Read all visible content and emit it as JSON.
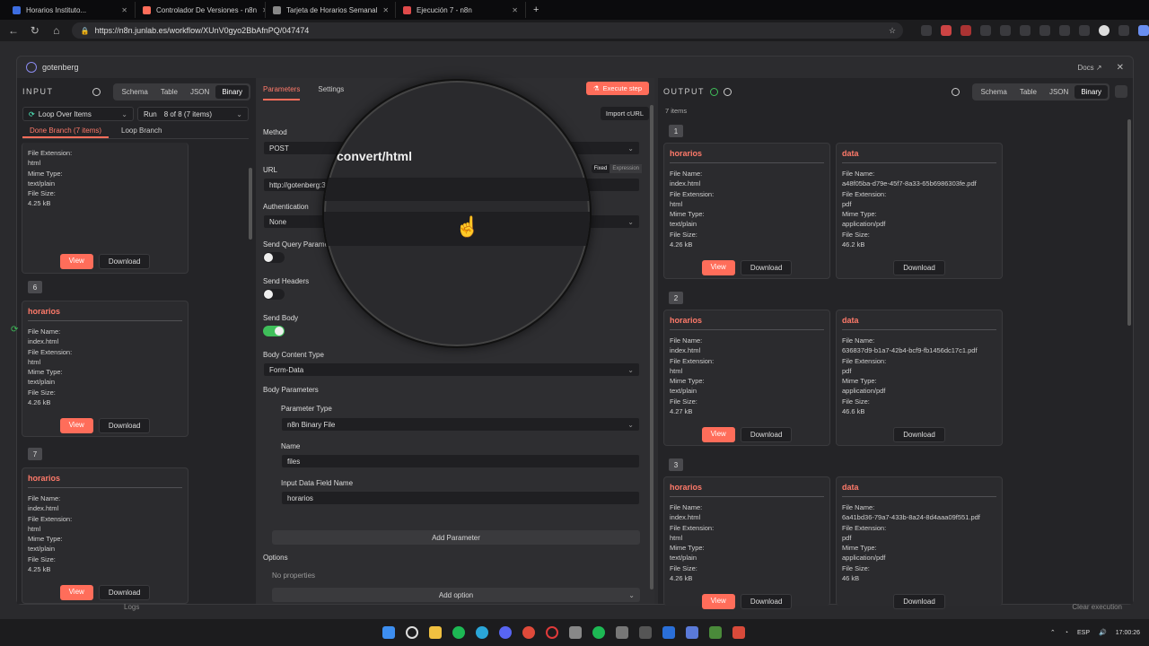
{
  "browser": {
    "tabs": [
      {
        "label": "Horarios Instituto..."
      },
      {
        "label": "Controlador De Versiones - n8n"
      },
      {
        "label": "Tarjeta de Horarios Semanal"
      },
      {
        "label": "Ejecución 7 - n8n"
      }
    ],
    "url": "https://n8n.junlab.es/workflow/XUnV0gyo2BbAfnPQ/047474"
  },
  "modal": {
    "node_name": "gotenberg",
    "docs_label": "Docs"
  },
  "input_pane": {
    "title": "INPUT",
    "view_tabs": [
      "Schema",
      "Table",
      "JSON",
      "Binary"
    ],
    "active_view": "Binary",
    "source_select": "Loop Over Items",
    "run_label": "Run",
    "run_select": "8 of 8 (7 items)",
    "branch_tabs": [
      "Done Branch (7 items)",
      "Loop Branch"
    ],
    "partial_card": {
      "rows": [
        "File Extension:",
        "html",
        "Mime Type:",
        "text/plain",
        "File Size:",
        "4.25 kB"
      ]
    },
    "items": [
      {
        "index": "6",
        "title": "horarios",
        "rows": [
          "File Name:",
          "index.html",
          "File Extension:",
          "html",
          "Mime Type:",
          "text/plain",
          "File Size:",
          "4.26 kB"
        ]
      },
      {
        "index": "7",
        "title": "horarios",
        "rows": [
          "File Name:",
          "index.html",
          "File Extension:",
          "html",
          "Mime Type:",
          "text/plain",
          "File Size:",
          "4.25 kB"
        ]
      }
    ],
    "view_label": "View",
    "download_label": "Download"
  },
  "params_pane": {
    "tabs": [
      "Parameters",
      "Settings"
    ],
    "execute_label": "Execute step",
    "import_curl": "Import cURL",
    "method_label": "Method",
    "method_value": "POST",
    "url_label": "URL",
    "url_value": "http://gotenberg:3",
    "url_mode": [
      "Fixed",
      "Expression"
    ],
    "auth_label": "Authentication",
    "auth_value": "None",
    "send_query_label": "Send Query Parame",
    "send_headers_label": "Send Headers",
    "send_body_label": "Send Body",
    "body_content_type_label": "Body Content Type",
    "body_content_type_value": "Form-Data",
    "body_params_label": "Body Parameters",
    "param_type_label": "Parameter Type",
    "param_type_value": "n8n Binary File",
    "name_label": "Name",
    "name_value": "files",
    "input_field_label": "Input Data Field Name",
    "input_field_value": "horarios",
    "add_parameter": "Add Parameter",
    "options_label": "Options",
    "no_properties": "No properties",
    "add_option": "Add option",
    "magnified_text": "convert/html"
  },
  "output_pane": {
    "title": "OUTPUT",
    "view_tabs": [
      "Schema",
      "Table",
      "JSON",
      "Binary"
    ],
    "active_view": "Binary",
    "count": "7 items",
    "items": [
      {
        "index": "1",
        "left": {
          "title": "horarios",
          "rows": [
            "File Name:",
            "index.html",
            "File Extension:",
            "html",
            "Mime Type:",
            "text/plain",
            "File Size:",
            "4.26 kB"
          ]
        },
        "right": {
          "title": "data",
          "rows": [
            "File Name:",
            "a48f05ba-d79e-45f7-8a33-65b6986303fe.pdf",
            "File Extension:",
            "pdf",
            "Mime Type:",
            "application/pdf",
            "File Size:",
            "46.2 kB"
          ]
        }
      },
      {
        "index": "2",
        "left": {
          "title": "horarios",
          "rows": [
            "File Name:",
            "index.html",
            "File Extension:",
            "html",
            "Mime Type:",
            "text/plain",
            "File Size:",
            "4.27 kB"
          ]
        },
        "right": {
          "title": "data",
          "rows": [
            "File Name:",
            "636837d9-b1a7-42b4-bcf9-fb1456dc17c1.pdf",
            "File Extension:",
            "pdf",
            "Mime Type:",
            "application/pdf",
            "File Size:",
            "46.6 kB"
          ]
        }
      },
      {
        "index": "3",
        "left": {
          "title": "horarios",
          "rows": [
            "File Name:",
            "index.html",
            "File Extension:",
            "html",
            "Mime Type:",
            "text/plain",
            "File Size:",
            "4.26 kB"
          ]
        },
        "right": {
          "title": "data",
          "rows": [
            "File Name:",
            "6a41bd36-79a7-433b-8a24-8d4aaa09f551.pdf",
            "File Extension:",
            "pdf",
            "Mime Type:",
            "application/pdf",
            "File Size:",
            "46 kB"
          ]
        }
      }
    ],
    "view_label": "View",
    "download_label": "Download"
  },
  "footer": {
    "logs_label": "Logs",
    "clear_execution": "Clear execution"
  },
  "taskbar": {
    "lang": "ESP",
    "time": "17:00:26"
  },
  "colors": {
    "accent": "#ff6d5a",
    "success": "#3fbf5a"
  }
}
